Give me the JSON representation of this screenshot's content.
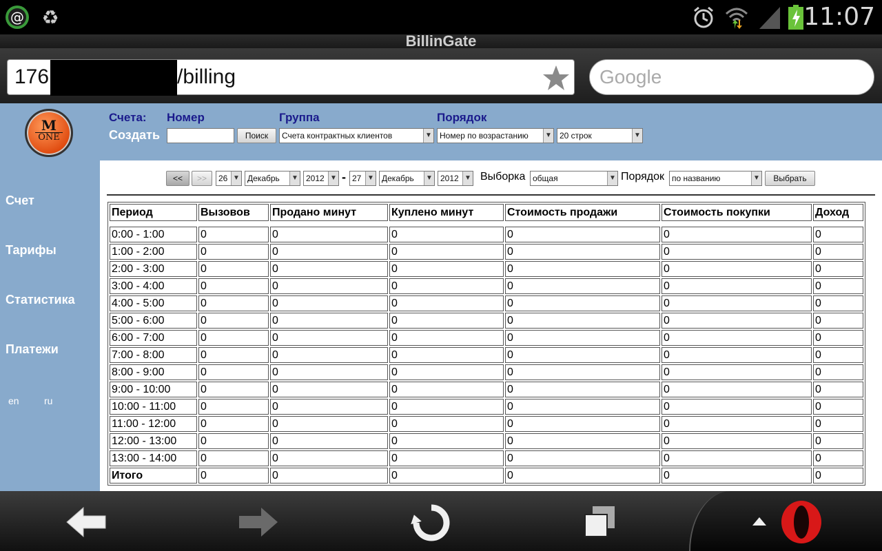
{
  "status_bar": {
    "time": "11:07",
    "icons": [
      "email-icon",
      "recycle-icon",
      "alarm-icon",
      "wifi-icon",
      "signal-icon",
      "battery-charging-icon"
    ]
  },
  "browser": {
    "title": "BillinGate",
    "url_prefix": "176.",
    "url_suffix": "/billing",
    "search_placeholder": "Google"
  },
  "logo": {
    "top": "M",
    "bottom": "ONE"
  },
  "form": {
    "accounts_label": "Счета:",
    "create_label": "Создать",
    "number_label": "Номер",
    "group_label": "Группа",
    "order_label": "Порядок",
    "search_button": "Поиск",
    "group_value": "Счета контрактных клиентов",
    "order_value": "Номер по возрастанию",
    "rows_value": "20 строк"
  },
  "sidebar": {
    "items": [
      "Счет",
      "Тарифы",
      "Статистика",
      "Платежи"
    ],
    "languages": [
      "en",
      "ru"
    ]
  },
  "filters": {
    "prev": "<<",
    "next": ">>",
    "from_day": "26",
    "from_month": "Декабрь",
    "from_year": "2012",
    "dash": "-",
    "to_day": "27",
    "to_month": "Декабрь",
    "to_year": "2012",
    "selection_label": "Выборка",
    "selection_value": "общая",
    "order_label": "Порядок",
    "order_value": "по названию",
    "select_button": "Выбрать"
  },
  "table": {
    "headers": [
      "Период",
      "Вызовов",
      "Продано минут",
      "Куплено минут",
      "Стоимость продажи",
      "Стоимость покупки",
      "Доход"
    ],
    "rows": [
      [
        "0:00 - 1:00",
        "0",
        "0",
        "0",
        "0",
        "0",
        "0"
      ],
      [
        "1:00 - 2:00",
        "0",
        "0",
        "0",
        "0",
        "0",
        "0"
      ],
      [
        "2:00 - 3:00",
        "0",
        "0",
        "0",
        "0",
        "0",
        "0"
      ],
      [
        "3:00 - 4:00",
        "0",
        "0",
        "0",
        "0",
        "0",
        "0"
      ],
      [
        "4:00 - 5:00",
        "0",
        "0",
        "0",
        "0",
        "0",
        "0"
      ],
      [
        "5:00 - 6:00",
        "0",
        "0",
        "0",
        "0",
        "0",
        "0"
      ],
      [
        "6:00 - 7:00",
        "0",
        "0",
        "0",
        "0",
        "0",
        "0"
      ],
      [
        "7:00 - 8:00",
        "0",
        "0",
        "0",
        "0",
        "0",
        "0"
      ],
      [
        "8:00 - 9:00",
        "0",
        "0",
        "0",
        "0",
        "0",
        "0"
      ],
      [
        "9:00 - 10:00",
        "0",
        "0",
        "0",
        "0",
        "0",
        "0"
      ],
      [
        "10:00 - 11:00",
        "0",
        "0",
        "0",
        "0",
        "0",
        "0"
      ],
      [
        "11:00 - 12:00",
        "0",
        "0",
        "0",
        "0",
        "0",
        "0"
      ],
      [
        "12:00 - 13:00",
        "0",
        "0",
        "0",
        "0",
        "0",
        "0"
      ],
      [
        "13:00 - 14:00",
        "0",
        "0",
        "0",
        "0",
        "0",
        "0"
      ]
    ],
    "total": [
      "Итого",
      "0",
      "0",
      "0",
      "0",
      "0",
      "0"
    ]
  },
  "bottom_nav": [
    "back-arrow-icon",
    "forward-arrow-icon",
    "reload-icon",
    "tabs-icon",
    "opera-menu-icon"
  ],
  "colors": {
    "page_bg": "#88aacc",
    "label_blue": "#1a1a8c",
    "logo_orange": "#e04b10",
    "opera_red": "#d81818"
  }
}
